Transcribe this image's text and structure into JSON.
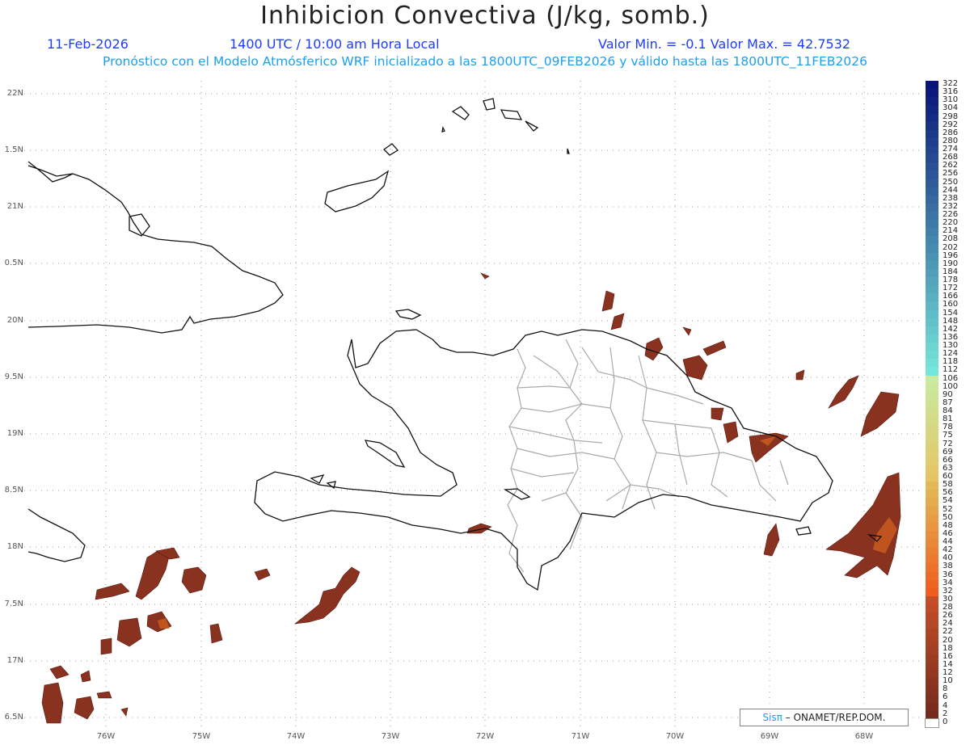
{
  "header": {
    "title": "Inhibicion Convectiva (J/kg, somb.)",
    "date": "11-Feb-2026",
    "time": "1400 UTC / 10:00 am Hora Local",
    "range": "Valor Min. = -0.1  Valor Max. = 42.7532",
    "forecast": "Pronóstico con el Modelo Atmósferico WRF inicializado a las 1800UTC_09FEB2026 y válido hasta las  1800UTC_11FEB2026"
  },
  "axes": {
    "lat_labels": [
      "22N",
      "1.5N",
      "21N",
      "0.5N",
      "20N",
      "9.5N",
      "19N",
      "8.5N",
      "18N",
      "7.5N",
      "17N",
      "6.5N"
    ],
    "lon_labels": [
      "76W",
      "75W",
      "74W",
      "73W",
      "72W",
      "71W",
      "70W",
      "69W",
      "68W"
    ]
  },
  "colorbar": {
    "labels": [
      "322",
      "316",
      "310",
      "304",
      "298",
      "292",
      "286",
      "280",
      "274",
      "268",
      "262",
      "256",
      "250",
      "244",
      "238",
      "232",
      "226",
      "220",
      "214",
      "208",
      "202",
      "196",
      "190",
      "184",
      "178",
      "172",
      "166",
      "160",
      "154",
      "148",
      "142",
      "136",
      "130",
      "124",
      "118",
      "112",
      "106",
      "100",
      "90",
      "87",
      "84",
      "81",
      "78",
      "75",
      "72",
      "69",
      "66",
      "63",
      "60",
      "58",
      "56",
      "54",
      "52",
      "50",
      "48",
      "46",
      "44",
      "42",
      "40",
      "38",
      "36",
      "34",
      "32",
      "30",
      "28",
      "26",
      "24",
      "22",
      "20",
      "18",
      "16",
      "14",
      "12",
      "10",
      "8",
      "6",
      "4",
      "2",
      "0"
    ]
  },
  "credit": {
    "brand": "Sisπ",
    "text": " – ONAMET/REP.DOM."
  },
  "colors": {
    "shade_dark": "#7a2a1c",
    "shade_mid": "#a8401f",
    "shade_light": "#e06020",
    "coast": "#111111",
    "provinces": "#aaaaaa"
  }
}
